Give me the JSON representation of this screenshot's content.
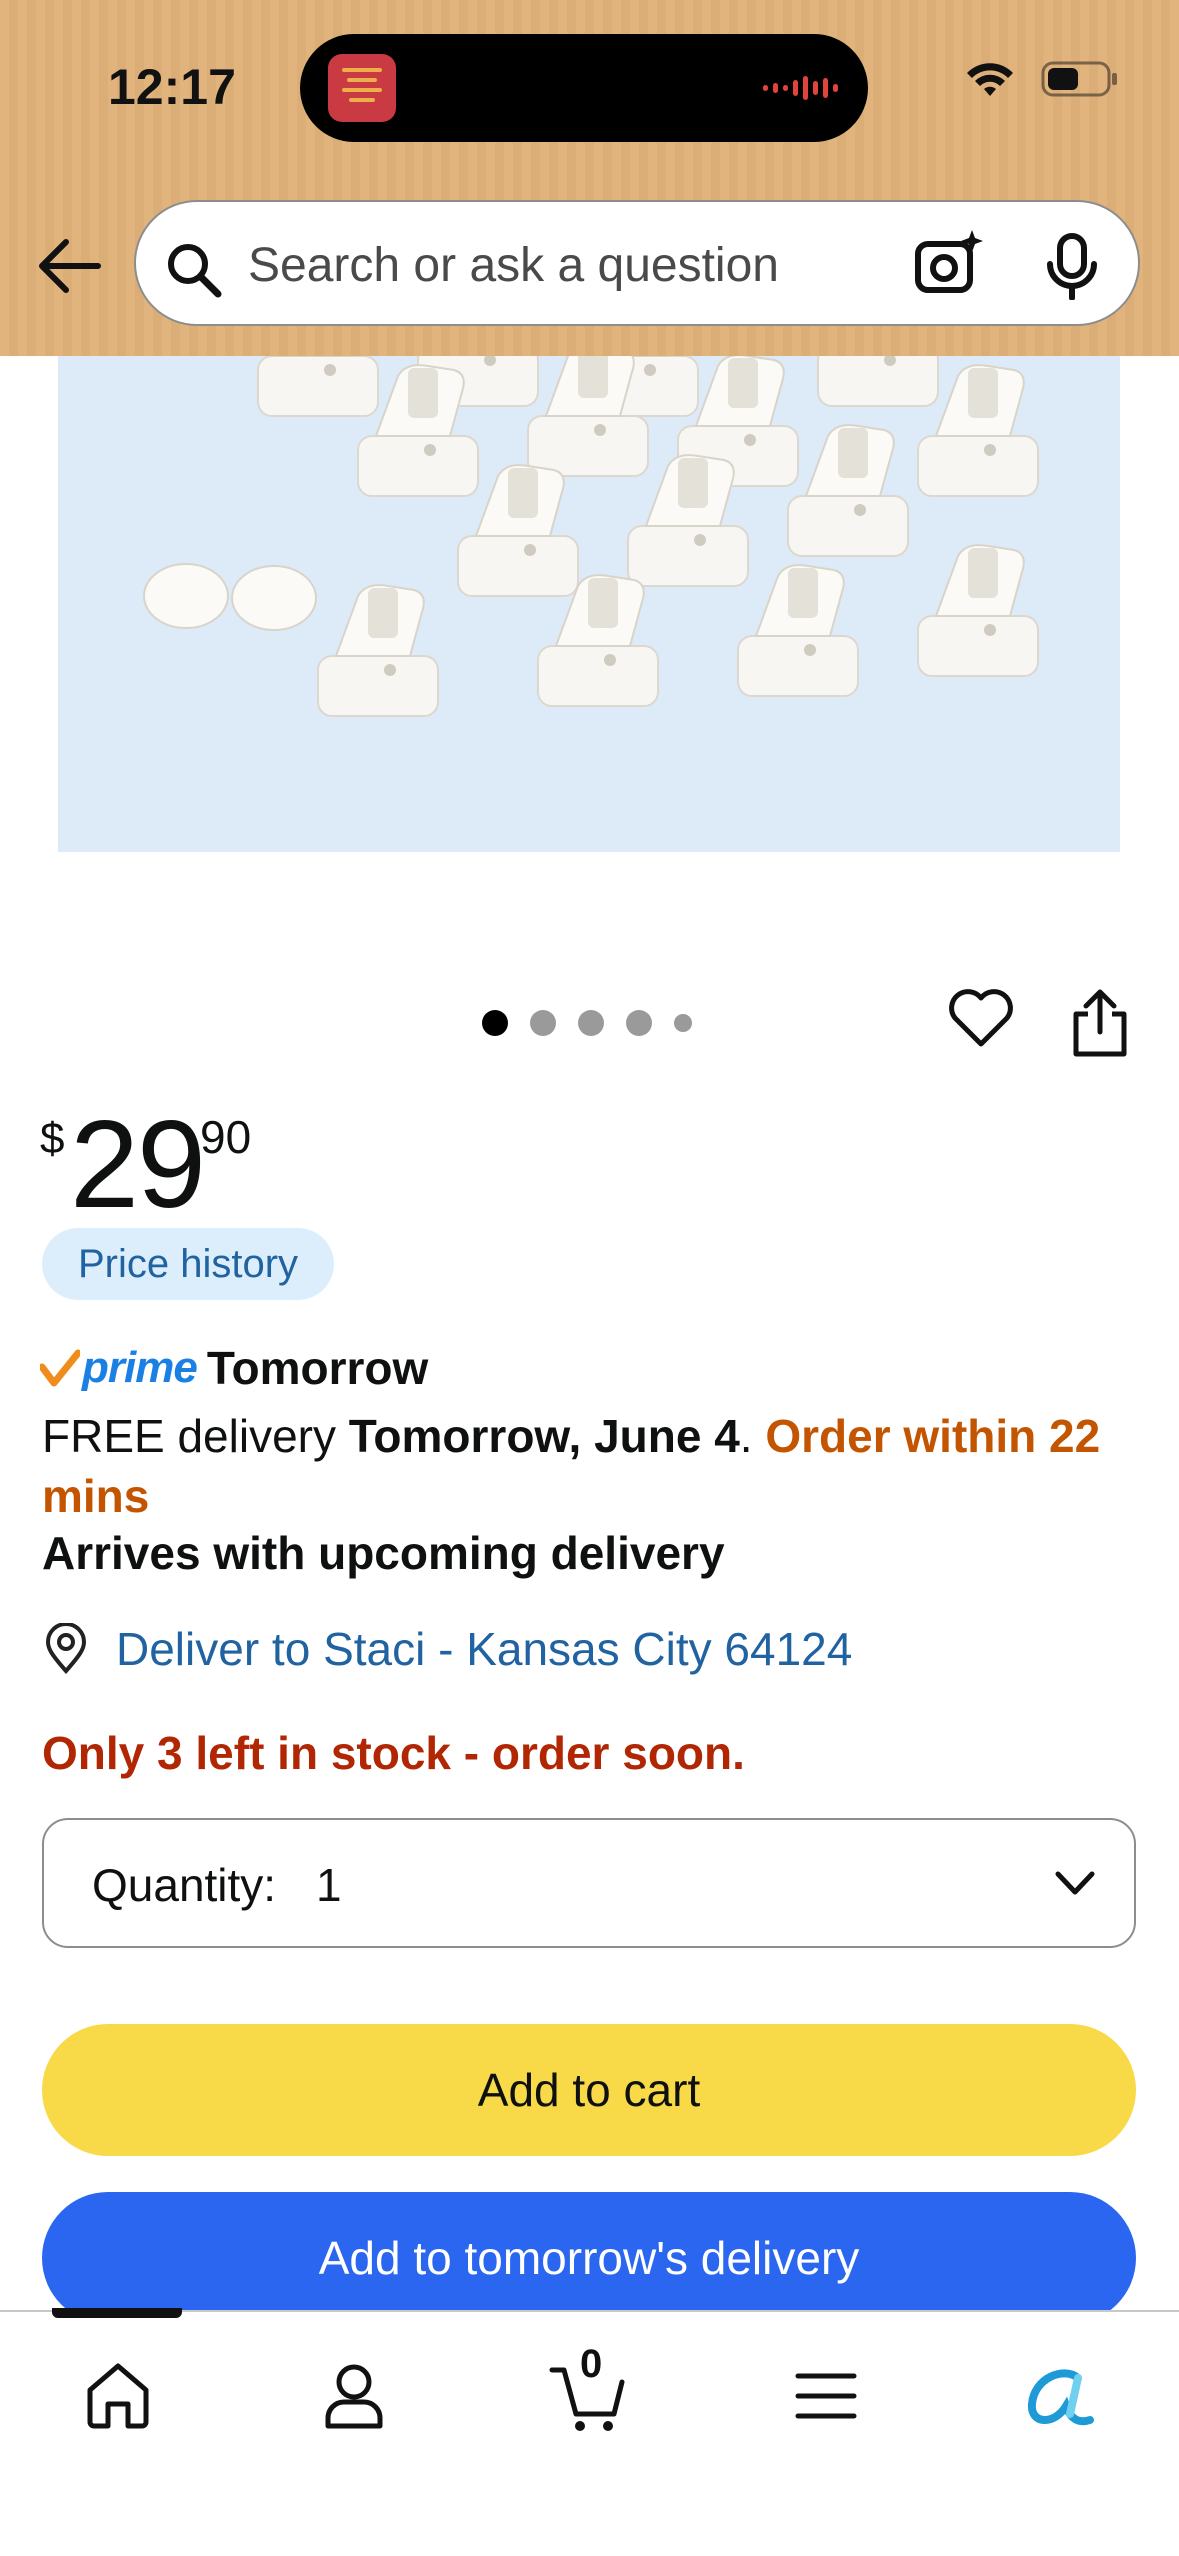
{
  "status_bar": {
    "time": "12:17"
  },
  "header": {
    "search_placeholder": "Search or ask a question",
    "icons": [
      "back-arrow-icon",
      "search-icon",
      "camera-icon",
      "microphone-icon"
    ]
  },
  "carousel": {
    "total_images": 5,
    "active_index": 0
  },
  "price": {
    "currency": "$",
    "whole": "29",
    "fraction": "90"
  },
  "price_history_label": "Price history",
  "prime": {
    "brand": "prime",
    "badge_text": "Tomorrow"
  },
  "delivery": {
    "prefix": "FREE delivery ",
    "date": "Tomorrow, June 4",
    "separator": ". ",
    "order_within": "Order within 22 mins"
  },
  "arrives_text": "Arrives with upcoming delivery",
  "deliver_to": "Deliver to Staci - Kansas City 64124",
  "stock_text": "Only 3 left in stock - order soon.",
  "quantity": {
    "label": "Quantity:",
    "value": "1"
  },
  "buttons": {
    "add_to_cart": "Add to cart",
    "add_to_tomorrow": "Add to tomorrow's delivery"
  },
  "bottom_nav": {
    "cart_count": "0",
    "items": [
      "home-icon",
      "account-icon",
      "cart-icon",
      "menu-icon",
      "rufus-icon"
    ]
  },
  "colors": {
    "header_bg": "#e2b47d",
    "add_to_cart_bg": "#f8d948",
    "add_to_tomorrow_bg": "#2a66f0",
    "link_blue": "#2162a1",
    "order_orange": "#c45500",
    "stock_red": "#b12704",
    "prime_blue": "#1b80e4"
  }
}
